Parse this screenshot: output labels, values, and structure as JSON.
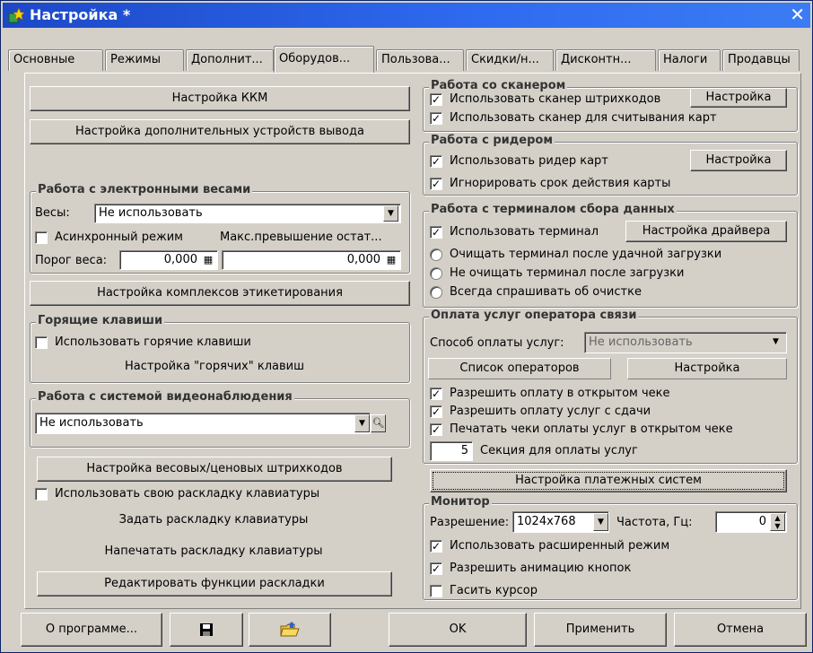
{
  "window": {
    "title": "Настройка *",
    "close": "✕"
  },
  "tabs": [
    "Основные",
    "Режимы",
    "Дополнит...",
    "Оборудов...",
    "Пользова...",
    "Скидки/н...",
    "Дисконтн...",
    "Налоги",
    "Продавцы"
  ],
  "active_tab": "Оборудов...",
  "left": {
    "kkm_button": "Настройка ККМ",
    "output_devices_button": "Настройка дополнительных устройств вывода",
    "scales": {
      "legend": "Работа с электронными весами",
      "scales_label": "Весы:",
      "scales_value": "Не использовать",
      "async_label": "Асинхронный режим",
      "async_checked": false,
      "max_excess_label": "Макс.превышение остат...",
      "threshold_label": "Порог веса:",
      "threshold_value": "0,000",
      "max_excess_value": "0,000"
    },
    "labeling_button": "Настройка комплексов этикетирования",
    "hotkeys": {
      "legend": "Горящие клавиши",
      "use_label": "Использовать горячие клавиши",
      "use_checked": false,
      "setup_button": "Настройка \"горячих\" клавиш"
    },
    "video": {
      "legend": "Работа с системой видеонаблюдения",
      "value": "Не использовать"
    },
    "barcodes_button": "Настройка весовых/ценовых штрихкодов",
    "own_layout_label": "Использовать свою раскладку клавиатуры",
    "own_layout_checked": false,
    "set_layout_button": "Задать раскладку клавиатуры",
    "print_layout_button": "Напечатать раскладку клавиатуры",
    "edit_layout_button": "Редактировать функции раскладки"
  },
  "right": {
    "scanner": {
      "legend": "Работа со сканером",
      "use_barcode_label": "Использовать сканер штрихкодов",
      "use_barcode_checked": true,
      "setup_button": "Настройка",
      "use_cards_label": "Использовать сканер для считывания карт",
      "use_cards_checked": true
    },
    "reader": {
      "legend": "Работа с ридером",
      "use_label": "Использовать ридер карт",
      "use_checked": true,
      "setup_button": "Настройка",
      "ignore_label": "Игнорировать срок действия карты",
      "ignore_checked": true
    },
    "terminal": {
      "legend": "Работа с терминалом сбора данных",
      "use_label": "Использовать терминал",
      "use_checked": true,
      "driver_button": "Настройка драйвера",
      "radio_options": [
        "Очищать терминал после удачной загрузки",
        "Не очищать терминал после загрузки",
        "Всегда спрашивать об очистке"
      ]
    },
    "payments": {
      "legend": "Оплата услуг оператора связи",
      "method_label": "Способ оплаты услуг:",
      "method_value": "Не использовать",
      "operators_button": "Список операторов",
      "setup_button": "Настройка",
      "allow_open_label": "Разрешить оплату в открытом чеке",
      "allow_change_label": "Разрешить оплату услуг с сдачи",
      "print_label": "Печатать чеки оплаты услуг в открытом чеке",
      "section_value": "5",
      "section_label": "Секция для оплаты услуг"
    },
    "payment_systems_button": "Настройка платежных систем",
    "monitor": {
      "legend": "Монитор",
      "resolution_label": "Разрешение:",
      "resolution_value": "1024x768",
      "freq_label": "Частота, Гц:",
      "freq_value": "0",
      "extended_label": "Использовать расширенный режим",
      "extended_checked": true,
      "animation_label": "Разрешить анимацию кнопок",
      "animation_checked": true,
      "cursor_label": "Гасить курсор",
      "cursor_checked": false
    }
  },
  "footer": {
    "about_button": "О программе...",
    "save_icon": "floppy-disk-icon",
    "load_icon": "folder-open-icon",
    "ok_button": "OK",
    "apply_button": "Применить",
    "cancel_button": "Отмена"
  }
}
